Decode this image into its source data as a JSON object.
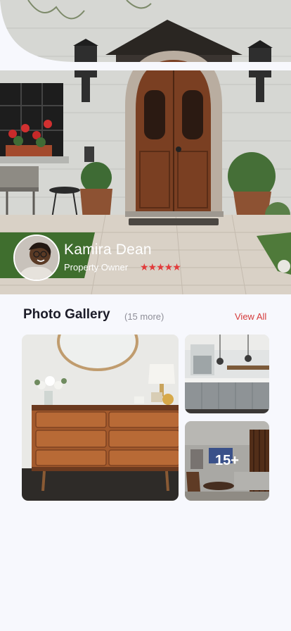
{
  "owner": {
    "name": "Kamira Dean",
    "role": "Property Owner",
    "rating_stars": "★★★★★",
    "rating": 5,
    "rating_max": 5
  },
  "gallery": {
    "title": "Photo Gallery",
    "more_text": "(15 more)",
    "view_all_label": "View All",
    "overlay_count": "15+"
  },
  "colors": {
    "accent": "#d53a3a",
    "background": "#f7f8fd",
    "text": "#1c1c28"
  }
}
